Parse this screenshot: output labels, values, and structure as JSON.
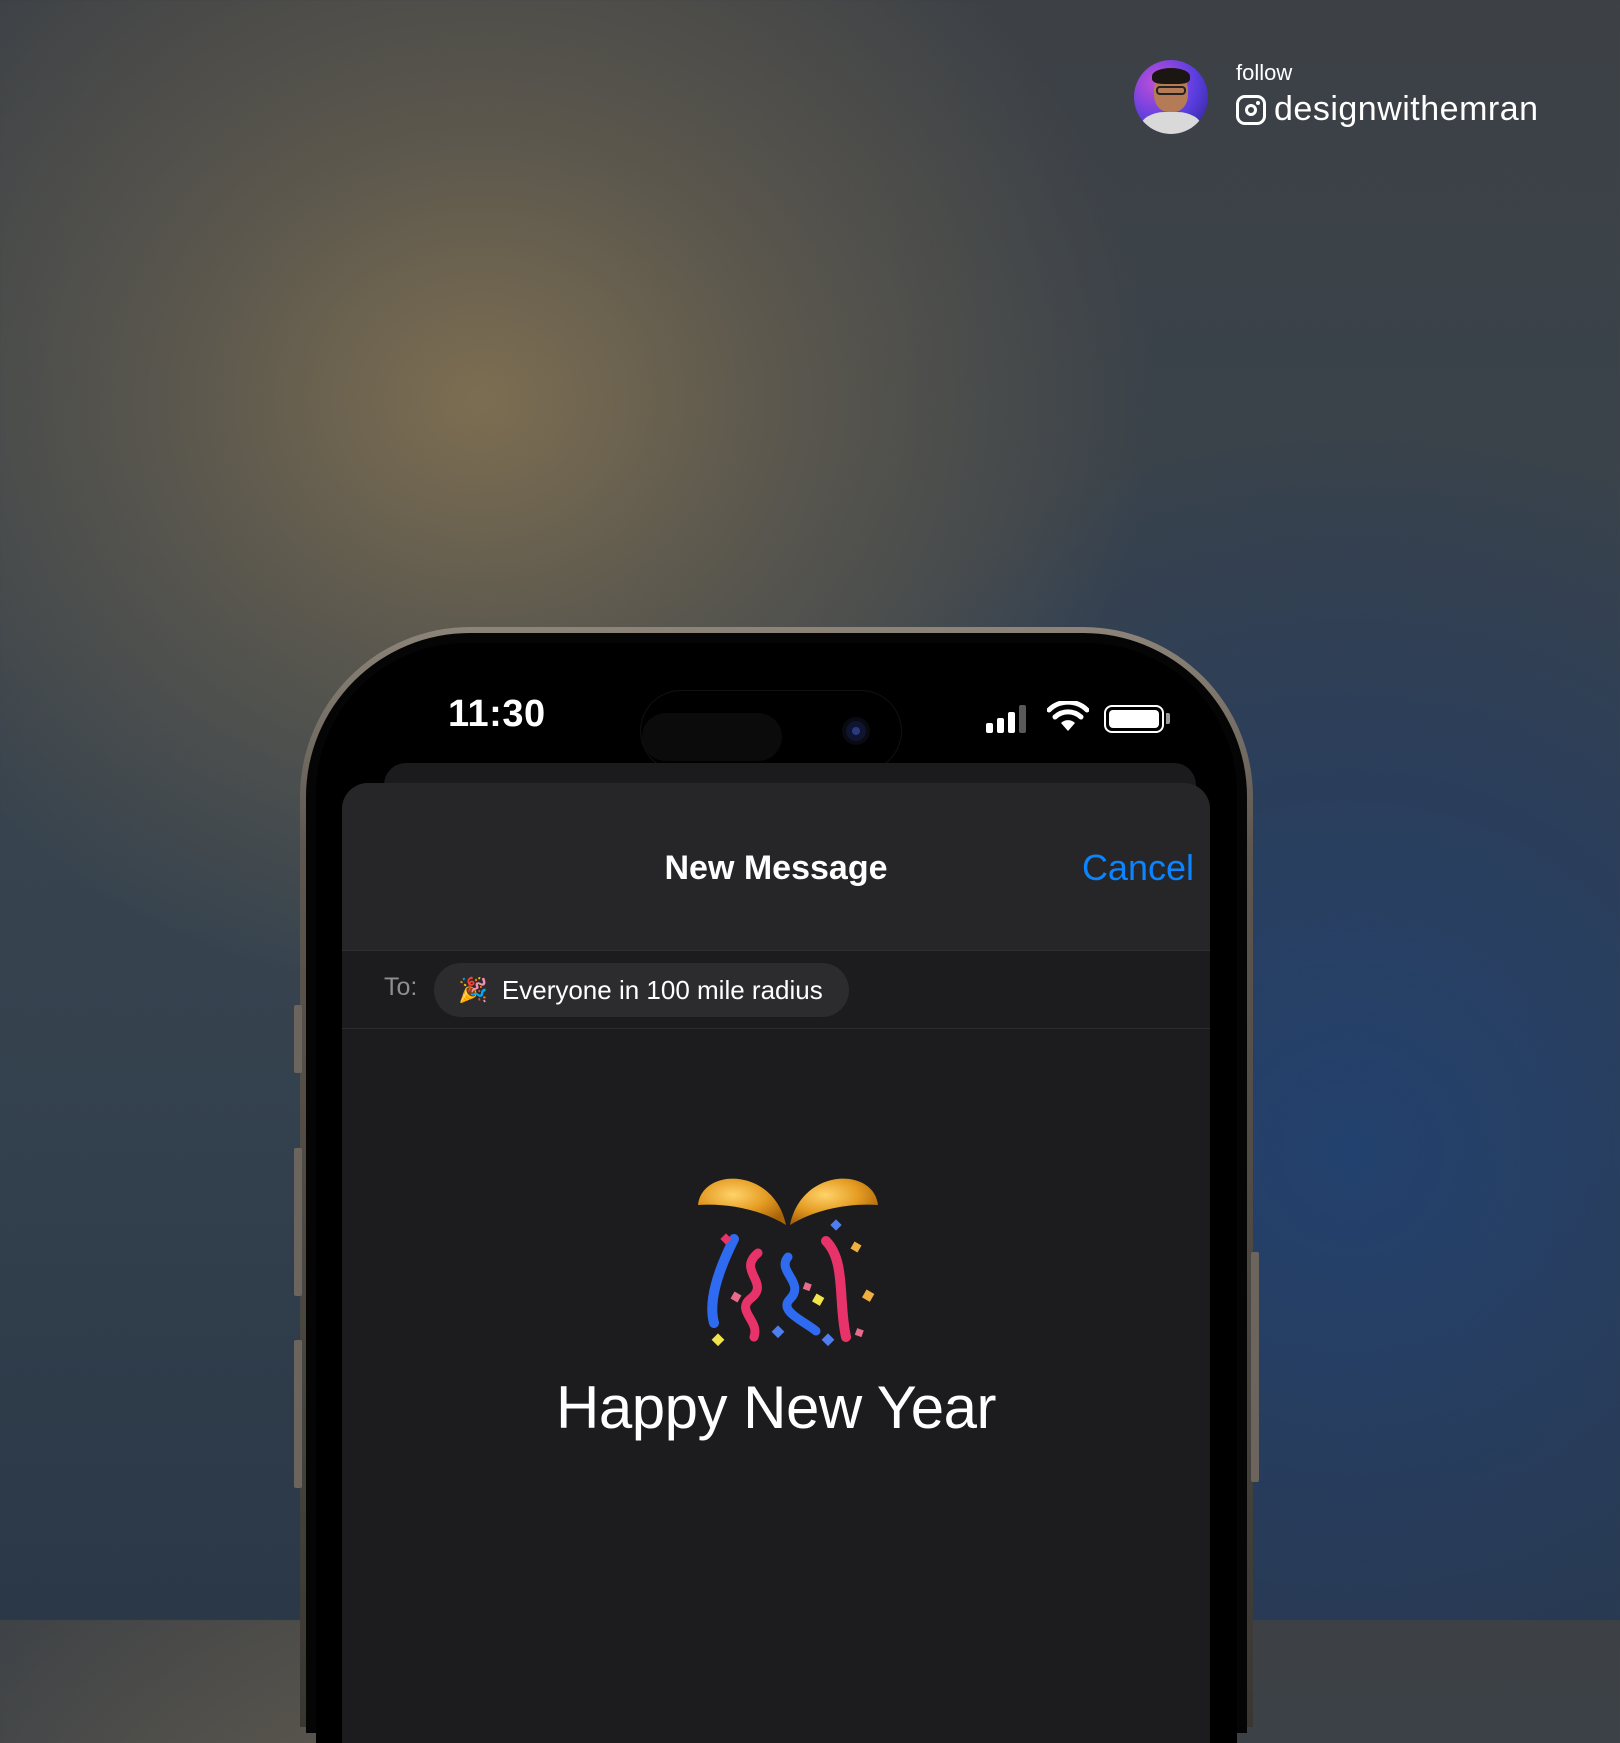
{
  "branding": {
    "follow_label": "follow",
    "handle": "designwithemran",
    "icon": "instagram-icon"
  },
  "status_bar": {
    "time": "11:30",
    "icons": [
      "cellular-signal-icon",
      "wifi-icon",
      "battery-icon"
    ]
  },
  "compose": {
    "title": "New Message",
    "cancel_label": "Cancel",
    "to_label": "To:",
    "recipient": {
      "emoji": "🎉",
      "label": "Everyone in 100 mile radius"
    },
    "message_emoji_icon": "confetti-ball-icon",
    "message_text": "Happy New Year"
  },
  "colors": {
    "accent": "#0a84ff",
    "sheet_background": "#1c1c1e",
    "header_background": "#262628",
    "chip_background": "#2c2c2e"
  }
}
